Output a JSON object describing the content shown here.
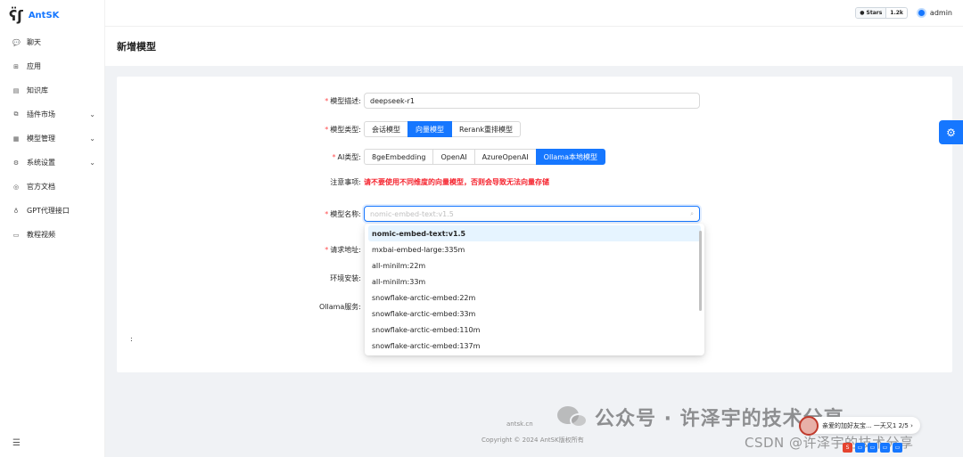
{
  "app": {
    "logo_mark": "ʕ̈ʃ",
    "name": "AntSK"
  },
  "sidebar": {
    "items": [
      {
        "label": "聊天",
        "icon": "chat-icon",
        "glyph": "💬",
        "expandable": false
      },
      {
        "label": "应用",
        "icon": "app-icon",
        "glyph": "⊞",
        "expandable": false
      },
      {
        "label": "知识库",
        "icon": "book-icon",
        "glyph": "▤",
        "expandable": false
      },
      {
        "label": "插件市场",
        "icon": "plugin-icon",
        "glyph": "⧉",
        "expandable": true
      },
      {
        "label": "模型管理",
        "icon": "grid-icon",
        "glyph": "▦",
        "expandable": true
      },
      {
        "label": "系统设置",
        "icon": "gear-icon",
        "glyph": "⚙",
        "expandable": true
      },
      {
        "label": "官方文档",
        "icon": "doc-icon",
        "glyph": "◎",
        "expandable": false
      },
      {
        "label": "GPT代理接口",
        "icon": "bulb-icon",
        "glyph": "♁",
        "expandable": false
      },
      {
        "label": "教程视频",
        "icon": "video-icon",
        "glyph": "▭",
        "expandable": false
      }
    ],
    "collapse_glyph": "☰"
  },
  "header": {
    "github": {
      "icon": "github-icon",
      "label": "Stars",
      "count": "1.2k"
    },
    "user": {
      "name": "admin"
    }
  },
  "page": {
    "title": "新增模型"
  },
  "form": {
    "description": {
      "label": "模型描述:",
      "value": "deepseek-r1",
      "required": true
    },
    "model_type": {
      "label": "模型类型:",
      "required": true,
      "options": [
        "会话模型",
        "向量模型",
        "Rerank重排模型"
      ],
      "selected": "向量模型"
    },
    "ai_type": {
      "label": "AI类型:",
      "required": true,
      "options": [
        "8geEmbedding",
        "OpenAI",
        "AzureOpenAI",
        "Ollama本地模型"
      ],
      "selected": "Ollama本地模型"
    },
    "notice": {
      "label": "注意事项:",
      "text": "请不要使用不同维度的向量模型，否则会导致无法向量存储"
    },
    "model_name": {
      "label": "模型名称:",
      "required": true,
      "placeholder": "nomic-embed-text:v1.5"
    },
    "request_url": {
      "label": "请求地址:",
      "required": true
    },
    "env_install": {
      "label": "环境安装:"
    },
    "ollama_service": {
      "label": "Ollama服务:"
    },
    "stray": ":"
  },
  "dropdown": {
    "options": [
      "nomic-embed-text:v1.5",
      "mxbai-embed-large:335m",
      "all-minilm:22m",
      "all-minilm:33m",
      "snowflake-arctic-embed:22m",
      "snowflake-arctic-embed:33m",
      "snowflake-arctic-embed:110m",
      "snowflake-arctic-embed:137m"
    ],
    "selected_index": 0
  },
  "footer": {
    "link": "antsk.cn",
    "copyright": "Copyright © 2024 AntSK版权所有"
  },
  "watermark": {
    "main": "公众号 · 许泽宇的技术分享",
    "csdn": "CSDN @许泽宇的技术分享",
    "notif": "亲爱的加好友宝... 一天又1 2/5  ›"
  },
  "colors": {
    "primary": "#1677ff",
    "danger": "#ff4d4f",
    "warning_text": "#f5222d"
  }
}
